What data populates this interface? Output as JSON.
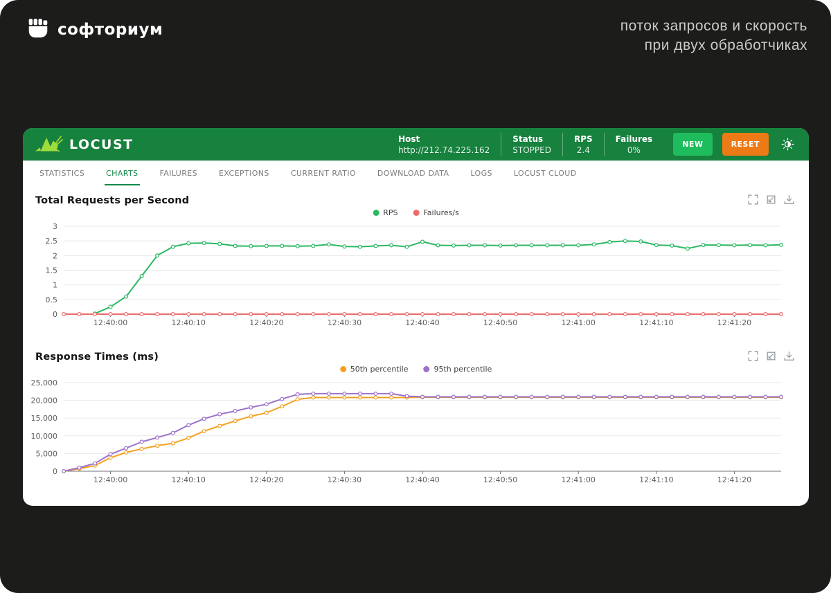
{
  "frame": {
    "brand": "софториум",
    "tagline_line1": "поток запросов и скорость",
    "tagline_line2": "при двух обработчиках"
  },
  "header": {
    "app_name": "LOCUST",
    "stats": [
      {
        "label": "Host",
        "value": "http://212.74.225.162"
      },
      {
        "label": "Status",
        "value": "STOPPED"
      },
      {
        "label": "RPS",
        "value": "2.4"
      },
      {
        "label": "Failures",
        "value": "0%"
      }
    ],
    "buttons": {
      "new": "NEW",
      "reset": "RESET"
    },
    "colors": {
      "header_bg": "#17813E",
      "new_btn": "#1FBC5D",
      "reset_btn": "#EB7A17"
    }
  },
  "tabs": {
    "items": [
      {
        "label": "STATISTICS"
      },
      {
        "label": "CHARTS"
      },
      {
        "label": "FAILURES"
      },
      {
        "label": "EXCEPTIONS"
      },
      {
        "label": "CURRENT RATIO"
      },
      {
        "label": "DOWNLOAD DATA"
      },
      {
        "label": "LOGS"
      },
      {
        "label": "LOCUST CLOUD"
      }
    ],
    "active": "CHARTS",
    "active_color": "#14874A"
  },
  "chart_data": [
    {
      "type": "line",
      "title": "Total Requests per Second",
      "legend_position": "top-center",
      "grid": true,
      "ylim": [
        0,
        3
      ],
      "y_ticks": [
        0,
        0.5,
        1,
        1.5,
        2,
        2.5,
        3
      ],
      "y_tick_labels": [
        "0",
        "0.5",
        "1",
        "1.5",
        "2",
        "2.5",
        "3"
      ],
      "t_domain": [
        0,
        92
      ],
      "x_tick_seconds": [
        6,
        16,
        26,
        36,
        46,
        56,
        66,
        76,
        86
      ],
      "x_tick_labels": [
        "12:40:00",
        "12:40:10",
        "12:40:20",
        "12:40:30",
        "12:40:40",
        "12:40:50",
        "12:41:00",
        "12:41:10",
        "12:41:20"
      ],
      "series": [
        {
          "name": "RPS",
          "color": "#2BB863",
          "t_start": 4,
          "t_step": 2,
          "values": [
            0.02,
            0.25,
            0.6,
            1.3,
            2.0,
            2.3,
            2.42,
            2.43,
            2.4,
            2.33,
            2.32,
            2.33,
            2.33,
            2.32,
            2.33,
            2.38,
            2.31,
            2.3,
            2.33,
            2.35,
            2.3,
            2.47,
            2.35,
            2.34,
            2.35,
            2.35,
            2.34,
            2.35,
            2.35,
            2.35,
            2.35,
            2.35,
            2.38,
            2.46,
            2.5,
            2.48,
            2.36,
            2.34,
            2.24,
            2.36,
            2.36,
            2.35,
            2.36,
            2.35,
            2.37
          ]
        },
        {
          "name": "Failures/s",
          "color": "#EE6B6B",
          "t_start": 0,
          "t_step": 2,
          "values": [
            0,
            0,
            0,
            0,
            0,
            0,
            0,
            0,
            0,
            0,
            0,
            0,
            0,
            0,
            0,
            0,
            0,
            0,
            0,
            0,
            0,
            0,
            0,
            0,
            0,
            0,
            0,
            0,
            0,
            0,
            0,
            0,
            0,
            0,
            0,
            0,
            0,
            0,
            0,
            0,
            0,
            0,
            0,
            0,
            0,
            0,
            0
          ]
        }
      ]
    },
    {
      "type": "line",
      "title": "Response Times (ms)",
      "legend_position": "top-center",
      "grid": true,
      "ylim": [
        0,
        25000
      ],
      "y_ticks": [
        0,
        5000,
        10000,
        15000,
        20000,
        25000
      ],
      "y_tick_labels": [
        "0",
        "5,000",
        "10,000",
        "15,000",
        "20,000",
        "25,000"
      ],
      "t_domain": [
        0,
        92
      ],
      "x_tick_seconds": [
        6,
        16,
        26,
        36,
        46,
        56,
        66,
        76,
        86
      ],
      "x_tick_labels": [
        "12:40:00",
        "12:40:10",
        "12:40:20",
        "12:40:30",
        "12:40:40",
        "12:40:50",
        "12:41:00",
        "12:41:10",
        "12:41:20"
      ],
      "series": [
        {
          "name": "50th percentile",
          "color": "#F5A11F",
          "t_start": 0,
          "t_step": 2,
          "values": [
            0,
            700,
            1600,
            3800,
            5300,
            6300,
            7200,
            7900,
            9400,
            11300,
            12800,
            14200,
            15500,
            16500,
            18300,
            20300,
            20800,
            20800,
            20800,
            20800,
            20800,
            20800,
            20800,
            20900,
            20900,
            20900,
            20900,
            20900,
            20900,
            20900,
            20900,
            20900,
            20900,
            20900,
            20900,
            20900,
            20900,
            20900,
            20900,
            20900,
            20900,
            20900,
            20900,
            20900,
            20900,
            20900,
            20900
          ]
        },
        {
          "name": "95th percentile",
          "color": "#9C72C9",
          "t_start": 0,
          "t_step": 2,
          "values": [
            0,
            1000,
            2200,
            4800,
            6500,
            8300,
            9500,
            10800,
            13000,
            14800,
            16100,
            17000,
            18000,
            18900,
            20400,
            21700,
            21900,
            21900,
            21900,
            21900,
            21900,
            21900,
            21200,
            21000,
            21000,
            21000,
            21000,
            21000,
            21000,
            21000,
            21000,
            21000,
            21000,
            21000,
            21000,
            21000,
            21000,
            21000,
            21000,
            21000,
            21000,
            21000,
            21000,
            21000,
            21000,
            21000,
            21000
          ]
        }
      ]
    }
  ]
}
